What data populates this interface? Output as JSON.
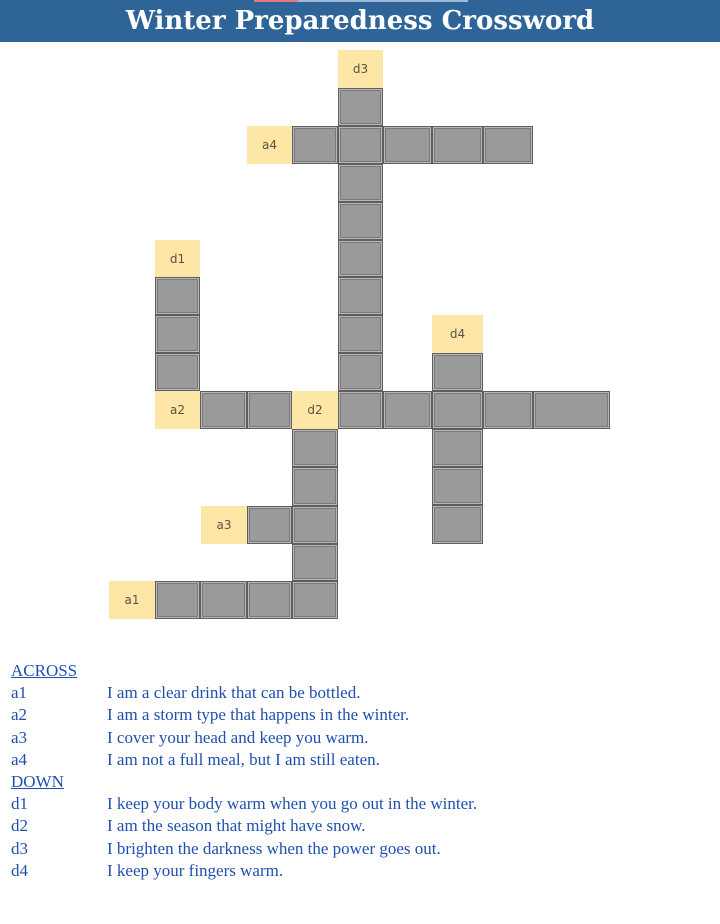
{
  "title": "Winter Preparedness Crossword",
  "labels": {
    "d3": "d3",
    "a4": "a4",
    "d1": "d1",
    "d4": "d4",
    "a2": "a2",
    "d2": "d2",
    "a3": "a3",
    "a1": "a1"
  },
  "across": {
    "heading": "ACROSS",
    "items": [
      {
        "num": "a1",
        "text": "I am a clear drink that can be bottled."
      },
      {
        "num": "a2",
        "text": "I am a storm type that happens in the winter."
      },
      {
        "num": "a3",
        "text": "I cover your head and keep you warm."
      },
      {
        "num": "a4",
        "text": "I am not a full meal, but I am still eaten."
      }
    ]
  },
  "down": {
    "heading": "DOWN",
    "items": [
      {
        "num": "d1",
        "text": "I keep your body warm when you go out in the winter."
      },
      {
        "num": "d2",
        "text": "I am the season that might have snow."
      },
      {
        "num": "d3",
        "text": "I brighten the darkness when the power goes out."
      },
      {
        "num": "d4",
        "text": "I keep your fingers warm."
      }
    ]
  }
}
